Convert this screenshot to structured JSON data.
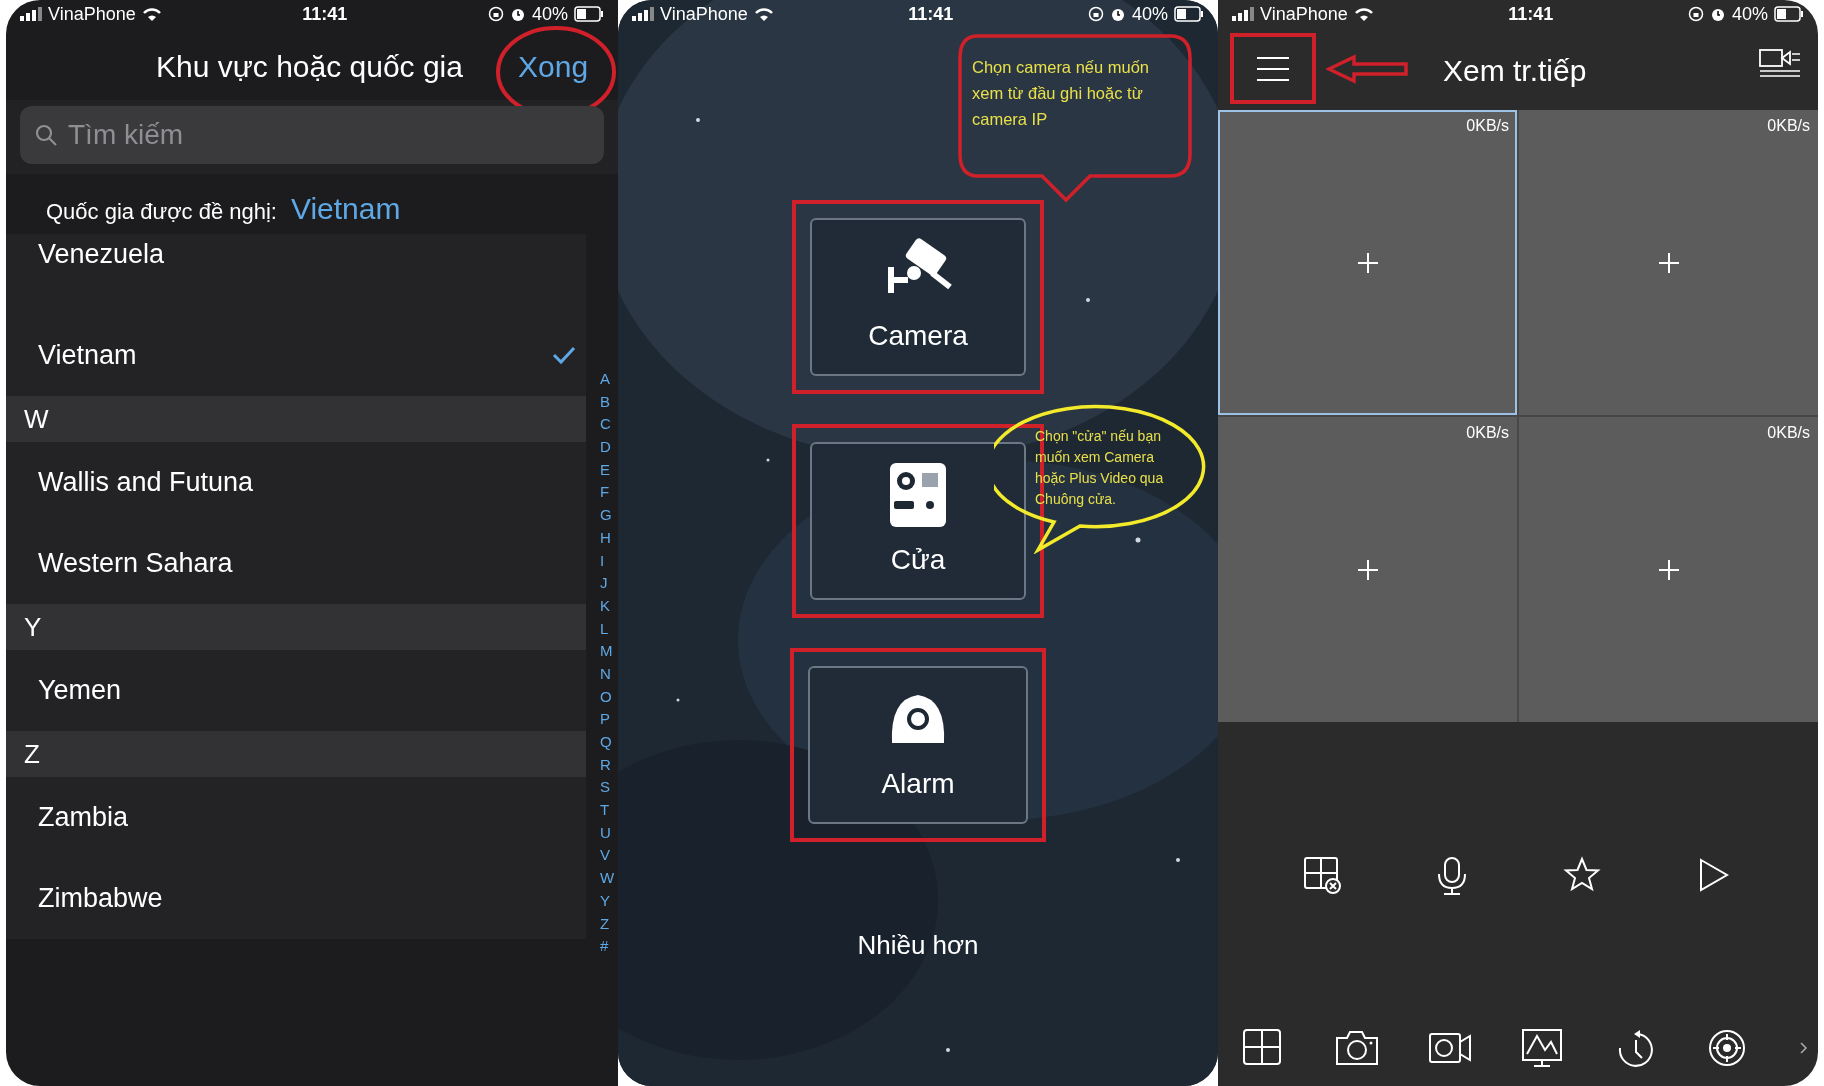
{
  "region_screen": {
    "status_bar": {
      "carrier": "VinaPhone",
      "time": "11:41",
      "battery": "40%"
    },
    "title": "Khu vực hoặc quốc gia",
    "done_button": "Xong",
    "search": {
      "placeholder": "Tìm kiếm"
    },
    "suggested": {
      "label": "Quốc gia được đề nghị:",
      "value": "Vietnam"
    },
    "rows": [
      {
        "kind": "item",
        "label": "Venezuela",
        "checked": false
      },
      {
        "kind": "item",
        "label": "Vietnam",
        "checked": true
      },
      {
        "kind": "header",
        "label": "W"
      },
      {
        "kind": "item",
        "label": "Wallis and Futuna",
        "checked": false
      },
      {
        "kind": "item",
        "label": "Western Sahara",
        "checked": false
      },
      {
        "kind": "header",
        "label": "Y"
      },
      {
        "kind": "item",
        "label": "Yemen",
        "checked": false
      },
      {
        "kind": "header",
        "label": "Z"
      },
      {
        "kind": "item",
        "label": "Zambia",
        "checked": false
      },
      {
        "kind": "item",
        "label": "Zimbabwe",
        "checked": false
      }
    ],
    "index": [
      "A",
      "B",
      "C",
      "D",
      "E",
      "F",
      "G",
      "H",
      "I",
      "J",
      "K",
      "L",
      "M",
      "N",
      "O",
      "P",
      "Q",
      "R",
      "S",
      "T",
      "U",
      "V",
      "W",
      "Y",
      "Z",
      "#"
    ]
  },
  "add_device_screen": {
    "status_bar": {
      "carrier": "VinaPhone",
      "time": "11:41",
      "battery": "40%"
    },
    "options": [
      {
        "kind": "camera",
        "label": "Camera"
      },
      {
        "kind": "door",
        "label": "Cửa"
      },
      {
        "kind": "alarm",
        "label": "Alarm"
      }
    ],
    "more": "Nhiều hơn",
    "callouts": [
      {
        "kind": "box",
        "text": "Chọn camera nếu muốn xem từ đầu ghi hoặc từ camera IP"
      },
      {
        "kind": "ellipse",
        "text": "Chọn \"cửa\" nếu bạn muốn xem Camera hoặc Plus Video qua Chuông cửa."
      }
    ]
  },
  "live_view_screen": {
    "status_bar": {
      "carrier": "VinaPhone",
      "time": "11:41",
      "battery": "40%"
    },
    "title": "Xem tr.tiếp",
    "cells": [
      {
        "rate": "0KB/s",
        "selected": true
      },
      {
        "rate": "0KB/s",
        "selected": false
      },
      {
        "rate": "0KB/s",
        "selected": false
      },
      {
        "rate": "0KB/s",
        "selected": false
      }
    ]
  }
}
